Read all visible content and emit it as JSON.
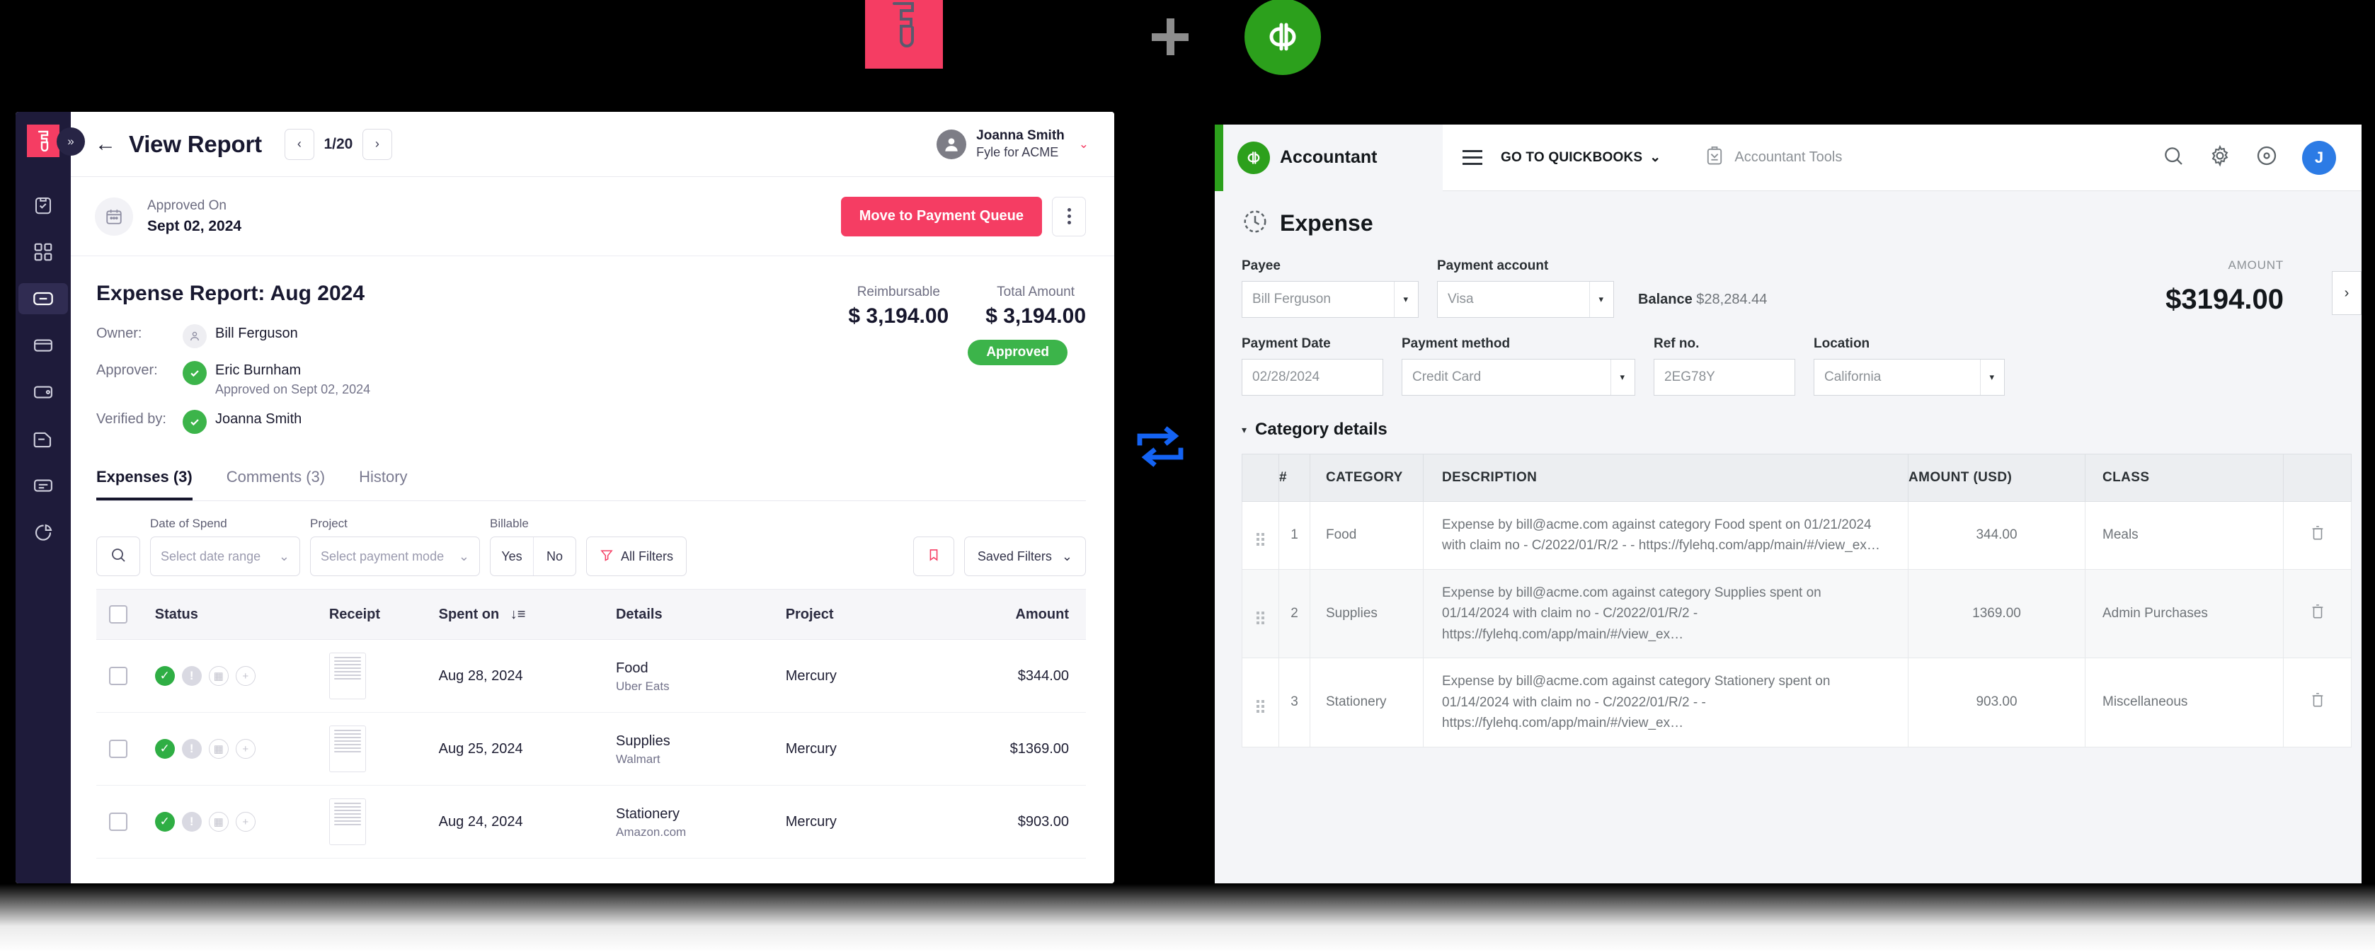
{
  "logos": {
    "fyle_label": "Fyle",
    "plus": "+",
    "quickbooks_label": "QuickBooks"
  },
  "fyle": {
    "sidebar": {
      "logo": "fyle-logo",
      "expand_icon": "chevrons-right-icon",
      "items": [
        {
          "icon": "clipboard-check-icon",
          "label": "Approvals",
          "active": false
        },
        {
          "icon": "grid-apps-icon",
          "label": "Dashboard",
          "active": false
        },
        {
          "icon": "folder-reports-icon",
          "label": "Reports",
          "active": true
        },
        {
          "icon": "card-icon",
          "label": "Cards",
          "active": false
        },
        {
          "icon": "wallet-icon",
          "label": "Wallet",
          "active": false
        },
        {
          "icon": "document-icon",
          "label": "Invoices",
          "active": false
        },
        {
          "icon": "list-icon",
          "label": "Advances",
          "active": false
        },
        {
          "icon": "pie-chart-icon",
          "label": "Analytics",
          "active": false
        }
      ]
    },
    "topbar": {
      "back_icon": "arrow-left-icon",
      "title": "View Report",
      "prev_icon": "chevron-left-icon",
      "next_icon": "chevron-right-icon",
      "page_count": "1/20",
      "user": {
        "name": "Joanna Smith",
        "org": "Fyle for ACME",
        "avatar_icon": "person-avatar-icon",
        "chevron": "chevron-down-icon"
      }
    },
    "approval_bar": {
      "icon": "calendar-icon",
      "label": "Approved On",
      "date": "Sept 02, 2024",
      "primary_button": "Move to Payment Queue",
      "kebab_icon": "more-vertical-icon"
    },
    "report": {
      "title": "Expense Report: Aug 2024",
      "owner_label": "Owner:",
      "owner_name": "Bill Ferguson",
      "approver_label": "Approver:",
      "approver_name": "Eric Burnham",
      "approver_sub": "Approved on Sept 02, 2024",
      "verified_label": "Verified by:",
      "verified_name": "Joanna Smith",
      "reimbursable_label": "Reimbursable",
      "reimbursable_value": "$ 3,194.00",
      "total_label": "Total Amount",
      "total_value": "$ 3,194.00",
      "status_badge": "Approved"
    },
    "tabs": [
      {
        "label": "Expenses (3)",
        "active": true
      },
      {
        "label": "Comments (3)",
        "active": false
      },
      {
        "label": "History",
        "active": false
      }
    ],
    "filters": {
      "search_icon": "search-icon",
      "date_caption": "Date of Spend",
      "date_placeholder": "Select date range",
      "project_caption": "Project",
      "project_placeholder": "Select payment mode",
      "billable_caption": "Billable",
      "billable_yes": "Yes",
      "billable_no": "No",
      "all_filters": "All Filters",
      "filter_icon": "funnel-icon",
      "bookmark_icon": "bookmark-icon",
      "saved_filters": "Saved Filters"
    },
    "expenses_table": {
      "columns": [
        "",
        "Status",
        "Receipt",
        "Spent on",
        "Details",
        "Project",
        "Amount"
      ],
      "sort_icon": "sort-desc-icon",
      "rows": [
        {
          "status_icons": [
            "check-circle-icon",
            "info-circle-icon",
            "receipt-icon",
            "plus-circle-icon"
          ],
          "receipt_icon": "receipt-thumbnail",
          "spent_on": "Aug 28, 2024",
          "detail_title": "Food",
          "detail_sub": "Uber Eats",
          "project": "Mercury",
          "amount": "$344.00"
        },
        {
          "status_icons": [
            "check-circle-icon",
            "info-circle-icon",
            "receipt-icon",
            "plus-circle-icon"
          ],
          "receipt_icon": "receipt-thumbnail",
          "spent_on": "Aug 25, 2024",
          "detail_title": "Supplies",
          "detail_sub": "Walmart",
          "project": "Mercury",
          "amount": "$1369.00"
        },
        {
          "status_icons": [
            "check-circle-icon",
            "info-circle-icon",
            "receipt-icon",
            "plus-circle-icon"
          ],
          "receipt_icon": "receipt-thumbnail",
          "spent_on": "Aug 24, 2024",
          "detail_title": "Stationery",
          "detail_sub": "Amazon.com",
          "project": "Mercury",
          "amount": "$903.00"
        }
      ]
    }
  },
  "sync": {
    "icon": "sync-arrows-icon",
    "color": "#1463F3"
  },
  "quickbooks": {
    "topbar": {
      "brand": "Accountant",
      "brand_icon": "qb-logo-icon",
      "menu_icon": "hamburger-icon",
      "goto_label": "GO TO QUICKBOOKS",
      "goto_chevron": "chevron-down-icon",
      "tools_icon": "toolbox-icon",
      "tools_label": "Accountant Tools",
      "search_icon": "search-icon",
      "settings_icon": "gear-icon",
      "help_icon": "help-circle-icon",
      "avatar_initial": "J"
    },
    "page": {
      "icon": "expense-clock-icon",
      "title": "Expense"
    },
    "form": {
      "payee_label": "Payee",
      "payee_value": "Bill Ferguson",
      "payment_account_label": "Payment account",
      "payment_account_value": "Visa",
      "balance_label": "Balance",
      "balance_value": "$28,284.44",
      "amount_caption": "AMOUNT",
      "amount_value": "$3194.00",
      "expand_icon": "chevron-right-icon",
      "payment_date_label": "Payment Date",
      "payment_date_value": "02/28/2024",
      "payment_method_label": "Payment method",
      "payment_method_value": "Credit Card",
      "ref_label": "Ref no.",
      "ref_value": "2EG78Y",
      "location_label": "Location",
      "location_value": "California"
    },
    "category_details": {
      "toggle_icon": "triangle-down-icon",
      "title": "Category details",
      "columns": [
        "",
        "#",
        "CATEGORY",
        "DESCRIPTION",
        "AMOUNT (USD)",
        "CLASS",
        ""
      ],
      "rows": [
        {
          "grip_icon": "drag-handle-icon",
          "num": "1",
          "category": "Food",
          "description": "Expense by bill@acme.com against category Food spent on 01/21/2024 with claim no - C/2022/01/R/2 - - https://fylehq.com/app/main/#/view_ex…",
          "amount": "344.00",
          "class": "Meals",
          "delete_icon": "trash-icon"
        },
        {
          "grip_icon": "drag-handle-icon",
          "num": "2",
          "category": "Supplies",
          "description": "Expense by bill@acme.com against category Supplies spent on 01/14/2024 with claim no - C/2022/01/R/2 - https://fylehq.com/app/main/#/view_ex…",
          "amount": "1369.00",
          "class": "Admin Purchases",
          "delete_icon": "trash-icon"
        },
        {
          "grip_icon": "drag-handle-icon",
          "num": "3",
          "category": "Stationery",
          "description": "Expense by bill@acme.com against category Stationery spent on 01/14/2024 with claim no - C/2022/01/R/2 - - https://fylehq.com/app/main/#/view_ex…",
          "amount": "903.00",
          "class": "Miscellaneous",
          "delete_icon": "trash-icon"
        }
      ]
    }
  },
  "colors": {
    "fyle_pink": "#F53D63",
    "qb_green": "#2CA01C",
    "approved_green": "#3CB44A",
    "sync_blue": "#1463F3",
    "sidebar_dark": "#1E1B3A"
  }
}
